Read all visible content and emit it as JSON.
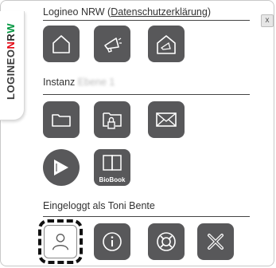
{
  "side_logo": {
    "part1": "LOGINEO",
    "n": "N",
    "r": "R",
    "w": "W"
  },
  "close_label": "x",
  "section1": {
    "title": "Logineo NRW (",
    "link": "Datenschutzerklärung",
    "title_end": ")"
  },
  "section2": {
    "title": "Instanz",
    "instance_name": "Ebene 1"
  },
  "section3": {
    "title": "Eingeloggt als Toni Bente"
  },
  "tiles": {
    "biobook_label": "BioBook"
  },
  "colors": {
    "tile": "#58585a",
    "text": "#333333",
    "logo_red": "#e30613",
    "logo_green": "#009640"
  }
}
